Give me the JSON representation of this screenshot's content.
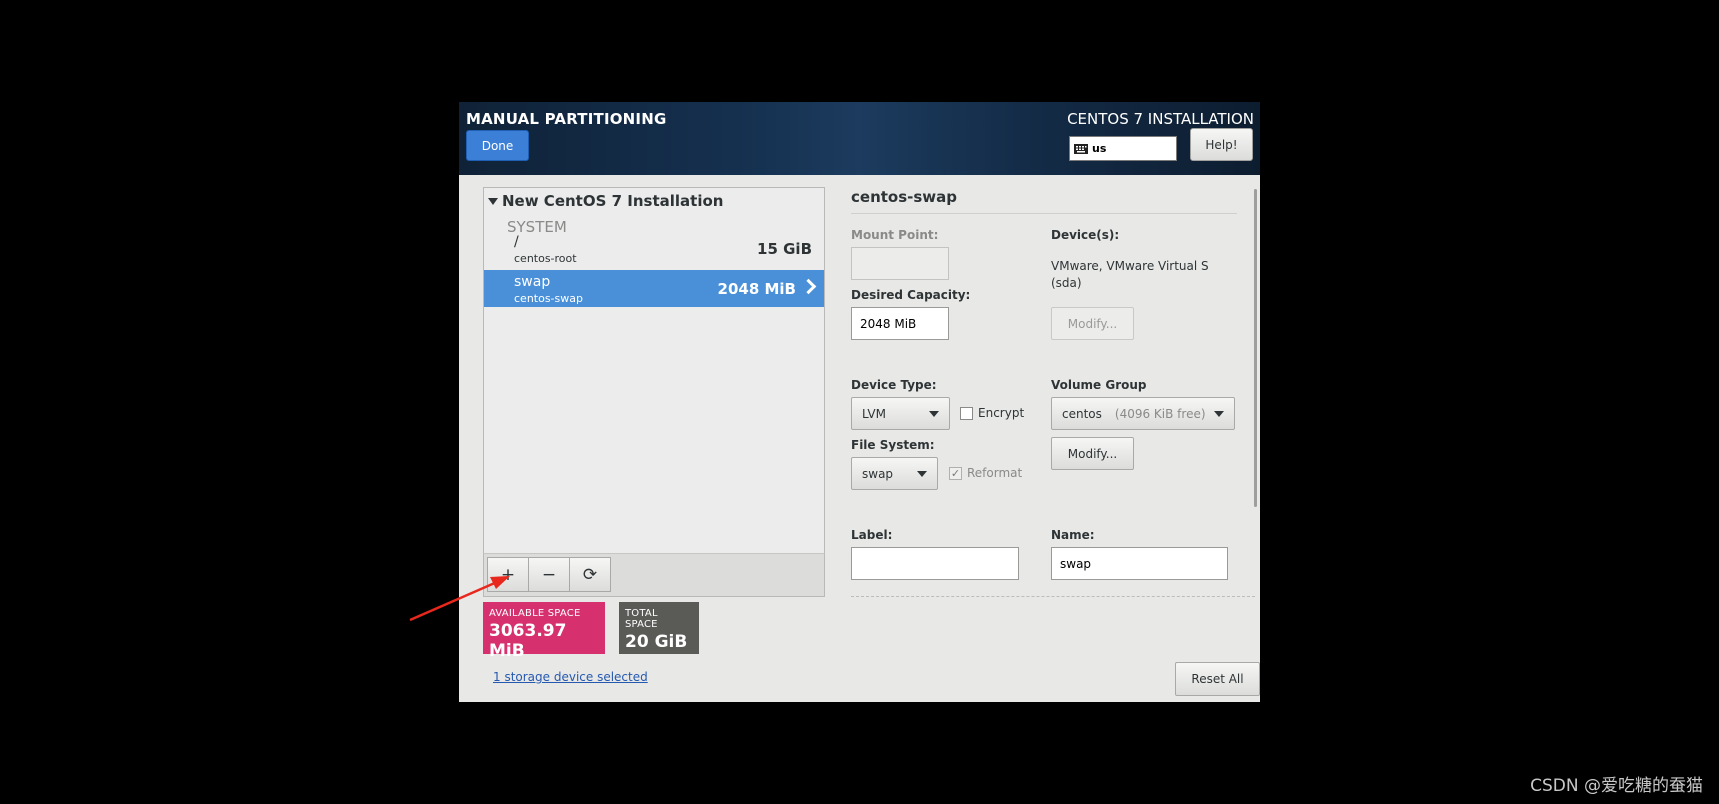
{
  "header": {
    "title": "MANUAL PARTITIONING",
    "product": "CENTOS 7 INSTALLATION",
    "done_label": "Done",
    "keyboard_layout": "us",
    "help_label": "Help!"
  },
  "tree": {
    "group_label": "New CentOS 7 Installation",
    "section_label": "SYSTEM",
    "items": [
      {
        "mount": "/",
        "name": "centos-root",
        "size": "15 GiB",
        "selected": false
      },
      {
        "mount": "swap",
        "name": "centos-swap",
        "size": "2048 MiB",
        "selected": true
      }
    ],
    "toolbar": {
      "add": "+",
      "remove": "−",
      "refresh": "⟳"
    }
  },
  "space": {
    "available_label": "AVAILABLE SPACE",
    "available_value": "3063.97 MiB",
    "available_color": "#d6306f",
    "total_label": "TOTAL SPACE",
    "total_value": "20 GiB",
    "total_color": "#5a5b57"
  },
  "storage_link": "1 storage device selected",
  "details": {
    "title": "centos-swap",
    "mount_point_label": "Mount Point:",
    "mount_point_value": "",
    "desired_capacity_label": "Desired Capacity:",
    "desired_capacity_value": "2048 MiB",
    "devices_label": "Device(s):",
    "devices_value": "VMware, VMware Virtual S (sda)",
    "modify_devices_label": "Modify...",
    "device_type_label": "Device Type:",
    "device_type_value": "LVM",
    "encrypt_label": "Encrypt",
    "encrypt_checked": false,
    "volume_group_label": "Volume Group",
    "volume_group_name": "centos",
    "volume_group_free": "(4096 KiB free)",
    "modify_vg_label": "Modify...",
    "file_system_label": "File System:",
    "file_system_value": "swap",
    "reformat_label": "Reformat",
    "reformat_checked": true,
    "label_label": "Label:",
    "label_value": "",
    "name_label": "Name:",
    "name_value": "swap",
    "reset_all_label": "Reset All"
  },
  "watermark": "CSDN @爱吃糖的蚕猫",
  "colors": {
    "accent_blue": "#3b7fd6",
    "selected_row": "#4a90d9",
    "annotation_arrow": "#e8281c"
  }
}
